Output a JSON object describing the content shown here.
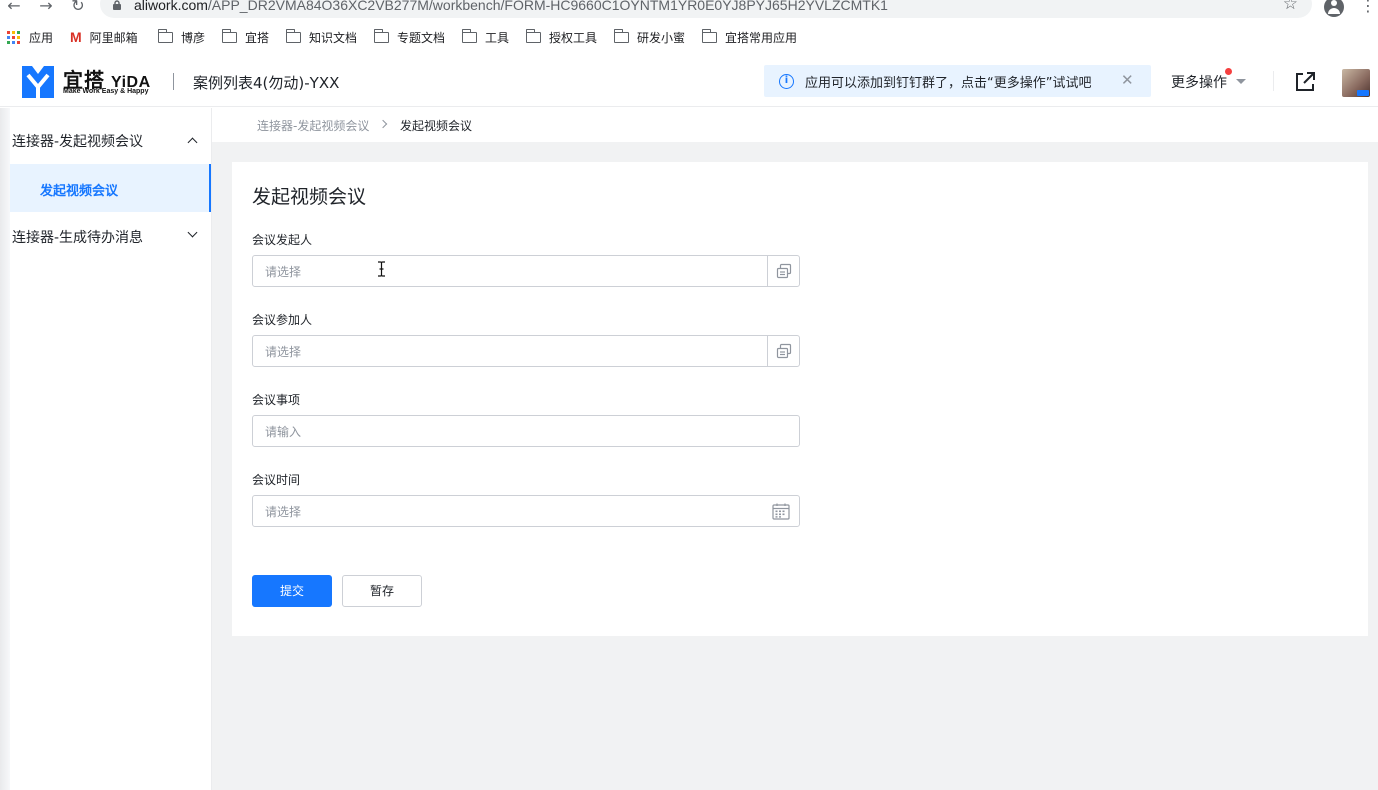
{
  "browser": {
    "url_host": "aliwork.com",
    "url_path": "/APP_DR2VMA84O36XC2VB277M/workbench/FORM-HC9660C1OYNTM1YR0E0YJ8PYJ65H2YVLZCMTK1",
    "bookmarks": [
      "应用",
      "阿里邮箱",
      "博彦",
      "宜搭",
      "知识文档",
      "专题文档",
      "工具",
      "授权工具",
      "研发小蜜",
      "宜搭常用应用"
    ]
  },
  "header": {
    "brand": "宜搭",
    "brand_en": "YiDA",
    "tagline": "Make Work Easy & Happy",
    "app_title": "案例列表4(勿动)-YXX",
    "notice": "应用可以添加到钉钉群了，点击“更多操作”试试吧",
    "more_actions": "更多操作"
  },
  "sidebar": {
    "groups": [
      {
        "label": "连接器-发起视频会议",
        "expanded": true,
        "items": [
          {
            "label": "发起视频会议",
            "active": true
          }
        ]
      },
      {
        "label": "连接器-生成待办消息",
        "expanded": false,
        "items": []
      }
    ]
  },
  "breadcrumb": [
    "连接器-发起视频会议",
    "发起视频会议"
  ],
  "form": {
    "title": "发起视频会议",
    "fields": [
      {
        "label": "会议发起人",
        "placeholder": "请选择",
        "type": "member-select"
      },
      {
        "label": "会议参加人",
        "placeholder": "请选择",
        "type": "member-select"
      },
      {
        "label": "会议事项",
        "placeholder": "请输入",
        "type": "text"
      },
      {
        "label": "会议时间",
        "placeholder": "请选择",
        "type": "date"
      }
    ],
    "submit": "提交",
    "save_draft": "暂存"
  },
  "colors": {
    "primary": "#1677ff",
    "notice_bg": "#e8f3ff",
    "page_bg": "#f1f2f3",
    "text": "#1f2329",
    "placeholder": "#8f959e",
    "notify_dot": "#f53f3f"
  },
  "icons": [
    "back-icon",
    "forward-icon",
    "reload-icon",
    "lock-icon",
    "star-icon",
    "profile-icon",
    "kebab-menu-icon",
    "apps-grid-icon",
    "gmail-icon",
    "folder-icon",
    "yida-logo-icon",
    "info-icon",
    "close-icon",
    "caret-down-icon",
    "open-external-icon",
    "chevron-up-icon",
    "chevron-down-icon",
    "chevron-right-icon",
    "member-picker-icon",
    "calendar-icon",
    "text-cursor-icon"
  ]
}
